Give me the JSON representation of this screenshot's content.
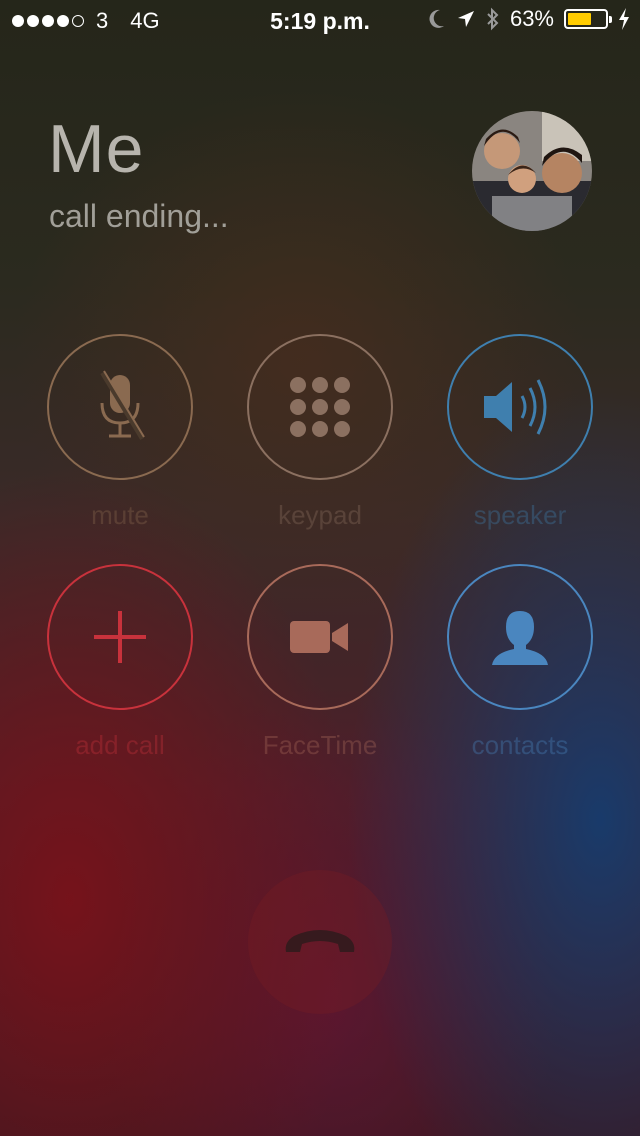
{
  "status_bar": {
    "carrier": "3",
    "network": "4G",
    "time": "5:19 p.m.",
    "battery_percent": "63%",
    "battery_level": 0.63,
    "battery_color": "#ffcc00",
    "signal_bars": 4
  },
  "call": {
    "caller_name": "Me",
    "status": "call ending..."
  },
  "buttons": {
    "mute": "mute",
    "keypad": "keypad",
    "speaker": "speaker",
    "add_call": "add call",
    "facetime": "FaceTime",
    "contacts": "contacts"
  },
  "colors": {
    "mute": "#8a6a50",
    "keypad": "#8b7060",
    "speaker": "#3f7fae",
    "add_call": "#c8323c",
    "facetime": "#a86a5a",
    "contacts": "#4a86bf"
  }
}
